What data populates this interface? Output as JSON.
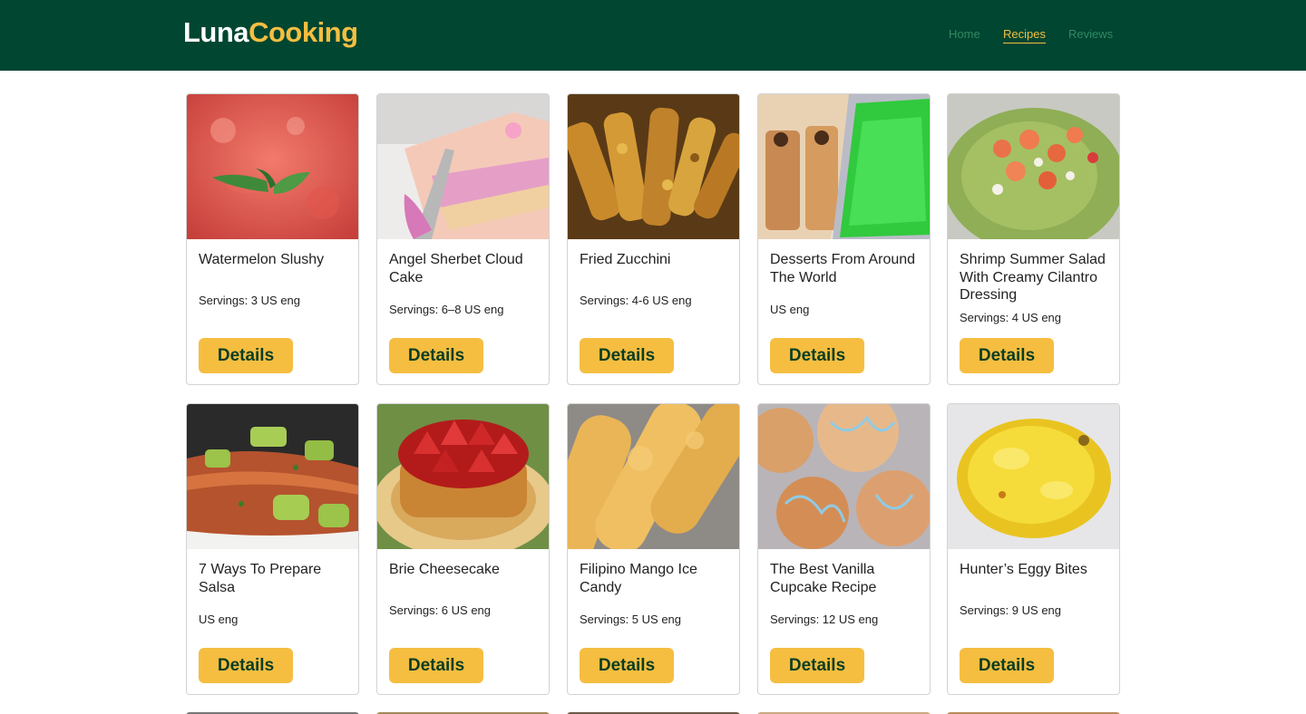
{
  "brand": {
    "part1": "Luna",
    "part2": "Cooking"
  },
  "nav": [
    {
      "label": "Home",
      "active": false
    },
    {
      "label": "Recipes",
      "active": true
    },
    {
      "label": "Reviews",
      "active": false
    }
  ],
  "colors": {
    "header_bg": "#004631",
    "accent": "#f5be41",
    "button_text": "#0b3d22"
  },
  "recipes": [
    {
      "title": "Watermelon Slushy",
      "servings": "Servings: 3 US eng",
      "button": "Details",
      "image": "watermelon-slushy-photo"
    },
    {
      "title": "Angel Sherbet Cloud Cake",
      "servings": "Servings: 6–8 US eng",
      "button": "Details",
      "image": "sherbet-cake-photo"
    },
    {
      "title": "Fried Zucchini",
      "servings": "Servings: 4-6 US eng",
      "button": "Details",
      "image": "fried-zucchini-photo"
    },
    {
      "title": "Desserts From Around The World",
      "servings": " US eng",
      "button": "Details",
      "image": "desserts-photo"
    },
    {
      "title": "Shrimp Summer Salad With Creamy Cilantro Dressing",
      "servings": "Servings: 4 US eng",
      "button": "Details",
      "image": "shrimp-salad-photo"
    },
    {
      "title": "7 Ways To Prepare Salsa",
      "servings": " US eng",
      "button": "Details",
      "image": "salsa-salmon-photo"
    },
    {
      "title": "Brie Cheesecake",
      "servings": "Servings: 6 US eng",
      "button": "Details",
      "image": "brie-cheesecake-photo"
    },
    {
      "title": "Filipino Mango Ice Candy",
      "servings": "Servings: 5 US eng",
      "button": "Details",
      "image": "mango-ice-candy-photo"
    },
    {
      "title": "The Best Vanilla Cupcake Recipe",
      "servings": "Servings: 12 US eng",
      "button": "Details",
      "image": "vanilla-cupcake-photo"
    },
    {
      "title": "Hunter’s Eggy Bites",
      "servings": "Servings: 9 US eng",
      "button": "Details",
      "image": "eggy-bites-photo"
    }
  ]
}
